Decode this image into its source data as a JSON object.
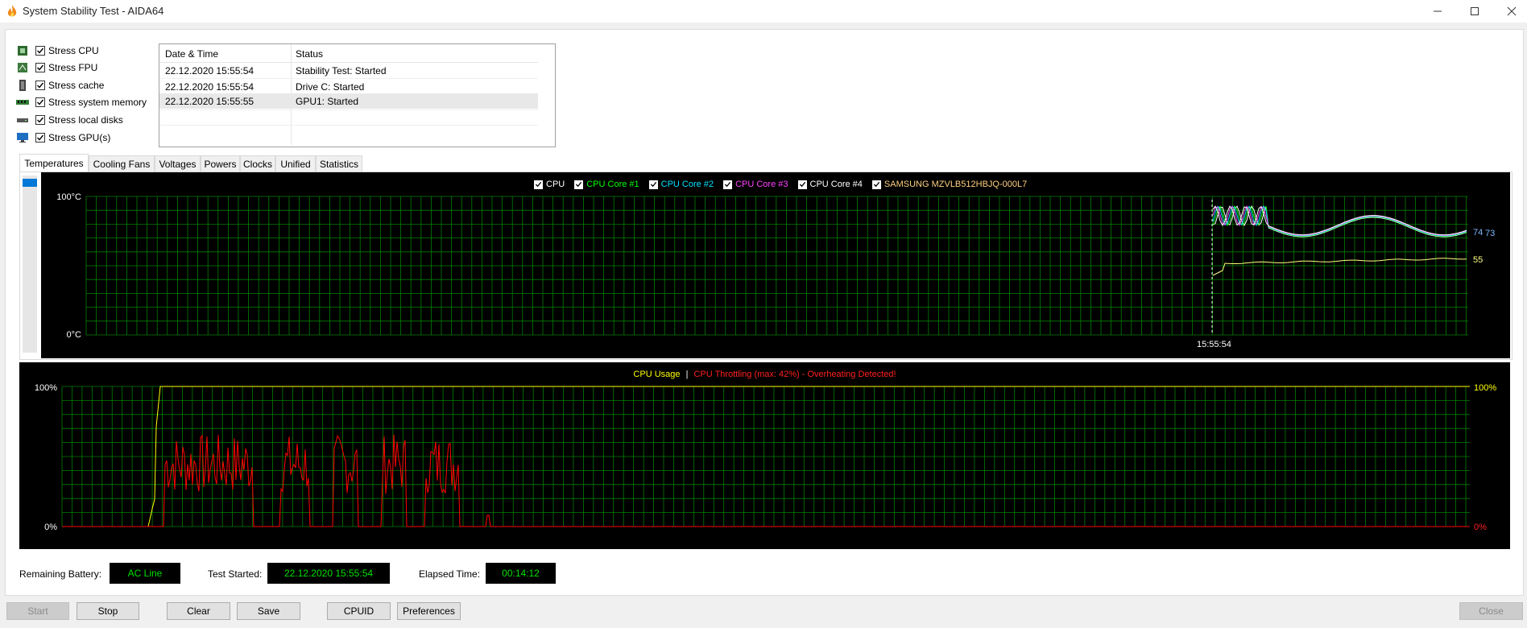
{
  "window": {
    "title": "System Stability Test - AIDA64"
  },
  "stress": [
    {
      "label": "Stress CPU",
      "checked": true,
      "icon": "cpu-icon"
    },
    {
      "label": "Stress FPU",
      "checked": true,
      "icon": "fpu-icon"
    },
    {
      "label": "Stress cache",
      "checked": true,
      "icon": "cache-icon"
    },
    {
      "label": "Stress system memory",
      "checked": true,
      "icon": "memory-icon"
    },
    {
      "label": "Stress local disks",
      "checked": true,
      "icon": "disk-icon"
    },
    {
      "label": "Stress GPU(s)",
      "checked": true,
      "icon": "gpu-icon"
    }
  ],
  "log": {
    "headers": [
      "Date & Time",
      "Status"
    ],
    "rows": [
      {
        "datetime": "22.12.2020 15:55:54",
        "status": "Stability Test: Started"
      },
      {
        "datetime": "22.12.2020 15:55:54",
        "status": "Drive C: Started"
      },
      {
        "datetime": "22.12.2020 15:55:55",
        "status": "GPU1: Started"
      }
    ]
  },
  "tabs": [
    "Temperatures",
    "Cooling Fans",
    "Voltages",
    "Powers",
    "Clocks",
    "Unified",
    "Statistics"
  ],
  "temp_chart": {
    "legend": [
      {
        "label": "CPU",
        "color": "#ffffff"
      },
      {
        "label": "CPU Core #1",
        "color": "#00ff00"
      },
      {
        "label": "CPU Core #2",
        "color": "#00e0ff"
      },
      {
        "label": "CPU Core #3",
        "color": "#ff40ff"
      },
      {
        "label": "CPU Core #4",
        "color": "#ffffff"
      },
      {
        "label": "SAMSUNG MZVLB512HBJQ-000L7",
        "color": "#ffff80"
      }
    ],
    "y_top": "100°C",
    "y_bottom": "0°C",
    "time_label": "15:55:54",
    "end_labels": [
      "74",
      "73",
      "55"
    ]
  },
  "usage_chart": {
    "title_usage": "CPU Usage",
    "separator": "|",
    "title_throttle": "CPU Throttling (max: 42%) - Overheating Detected!",
    "left_top": "100%",
    "left_bottom": "0%",
    "right_top": "100%",
    "right_bottom": "0%"
  },
  "status": {
    "battery_label": "Remaining Battery:",
    "battery_value": "AC Line",
    "started_label": "Test Started:",
    "started_value": "22.12.2020 15:55:54",
    "elapsed_label": "Elapsed Time:",
    "elapsed_value": "00:14:12"
  },
  "buttons": {
    "start": "Start",
    "stop": "Stop",
    "clear": "Clear",
    "save": "Save",
    "cpuid": "CPUID",
    "preferences": "Preferences",
    "close": "Close"
  },
  "colors": {
    "grid": "#008000",
    "usage": "#ffff00",
    "throttle": "#ff0000"
  }
}
